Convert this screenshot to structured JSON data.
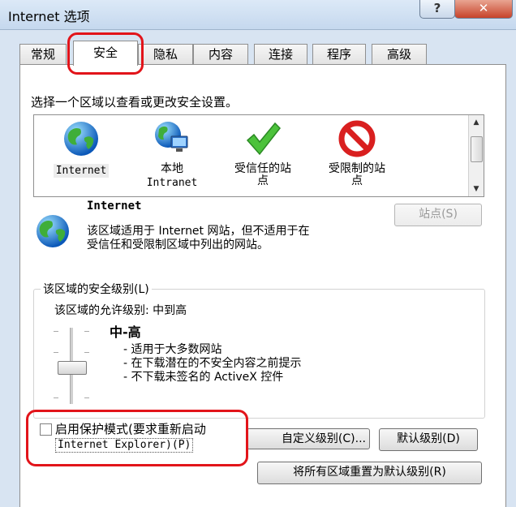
{
  "window": {
    "title": "Internet 选项",
    "help": "?",
    "close": "✕"
  },
  "tabs": [
    "常规",
    "安全",
    "隐私",
    "内容",
    "连接",
    "程序",
    "高级"
  ],
  "security": {
    "instruction": "选择一个区域以查看或更改安全设置。",
    "zones": [
      {
        "line1": "Internet",
        "line2": ""
      },
      {
        "line1": "本地",
        "line2": "Intranet"
      },
      {
        "line1": "受信任的站",
        "line2": "点"
      },
      {
        "line1": "受限制的站",
        "line2": "点"
      }
    ],
    "selected_zone_title": "Internet",
    "selected_zone_desc_1": "该区域适用于 Internet 网站，但不适用于在",
    "selected_zone_desc_2": "受信任和受限制区域中列出的网站。",
    "sites_button": "站点(S)",
    "level_group_title": "该区域的安全级别(L)",
    "allowed_levels": "该区域的允许级别: 中到高",
    "level_name": "中-高",
    "level_points": [
      "- 适用于大多数网站",
      "- 在下载潜在的不安全内容之前提示",
      "- 不下载未签名的 ActiveX 控件"
    ],
    "protected_mode_1": "启用保护模式(要求重新启动",
    "protected_mode_2": "Internet Explorer)(P)",
    "protected_mode_checked": false,
    "custom_level_button": "自定义级别(C)...",
    "default_level_button": "默认级别(D)",
    "reset_all_button": "将所有区域重置为默认级别(R)"
  },
  "colors": {
    "highlight_ring": "#e2141a"
  }
}
